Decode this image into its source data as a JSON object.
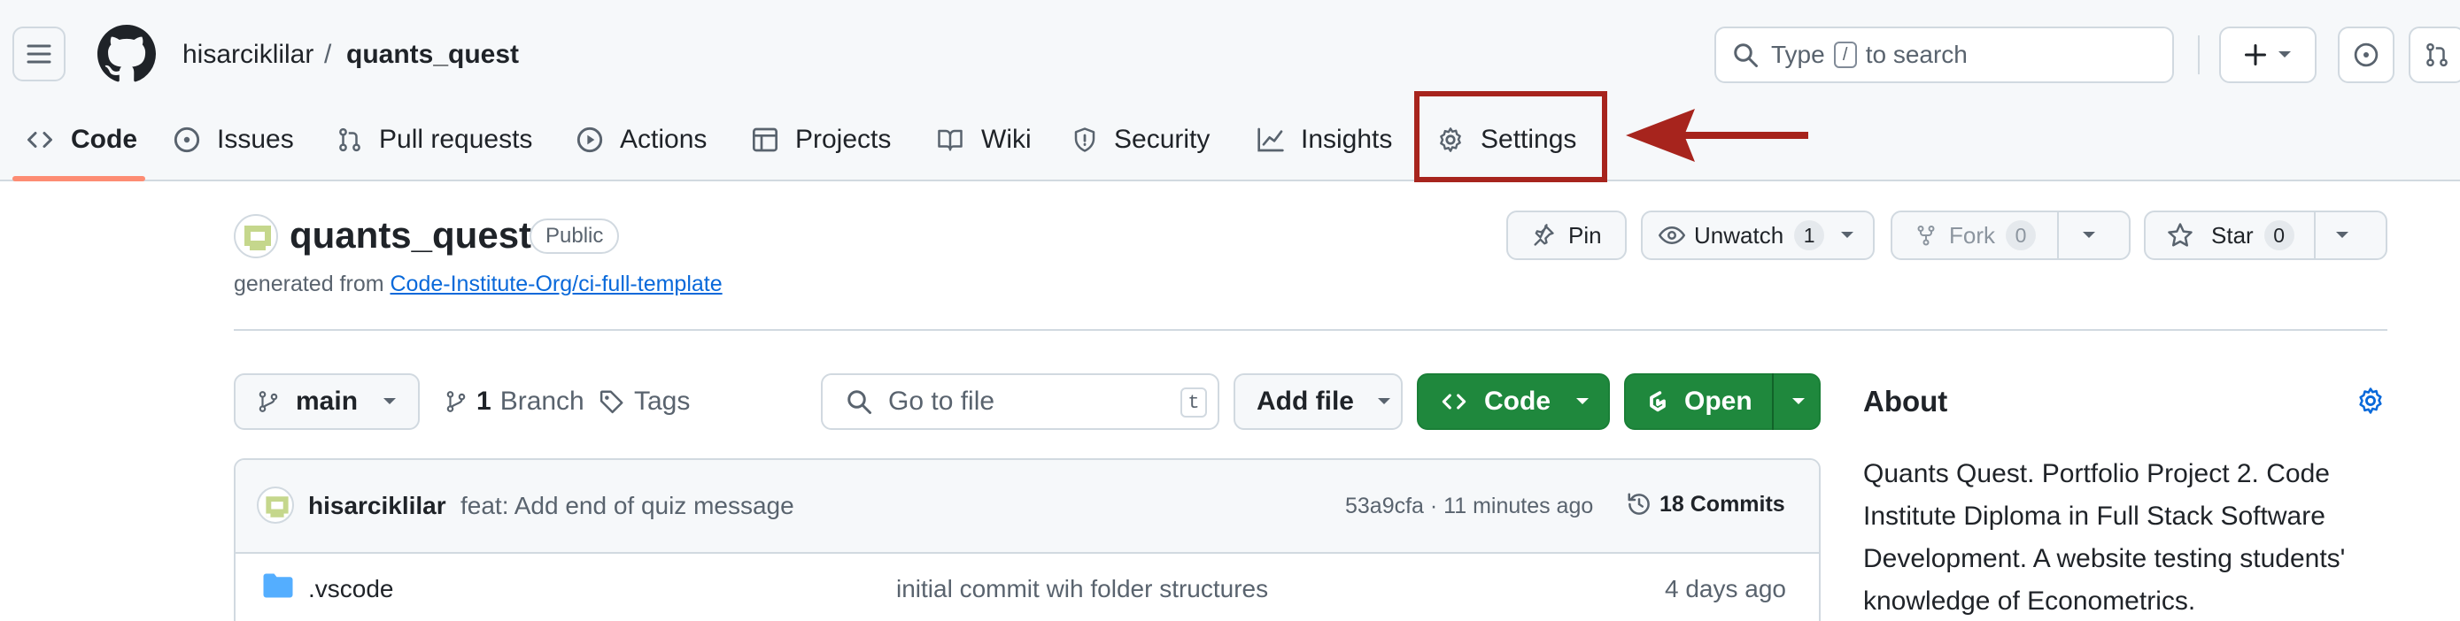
{
  "header": {
    "owner": "hisarciklilar",
    "separator": "/",
    "repo": "quants_quest",
    "search": {
      "prefix": "Type",
      "key": "/",
      "suffix": "to search"
    }
  },
  "tabs": [
    {
      "label": "Code",
      "icon": "code-icon",
      "active": true
    },
    {
      "label": "Issues",
      "icon": "issue-icon"
    },
    {
      "label": "Pull requests",
      "icon": "pull-request-icon"
    },
    {
      "label": "Actions",
      "icon": "play-icon"
    },
    {
      "label": "Projects",
      "icon": "table-icon"
    },
    {
      "label": "Wiki",
      "icon": "book-icon"
    },
    {
      "label": "Security",
      "icon": "shield-icon"
    },
    {
      "label": "Insights",
      "icon": "graph-icon"
    },
    {
      "label": "Settings",
      "icon": "gear-icon",
      "highlighted": true
    }
  ],
  "annotation": {
    "color": "#a7241d",
    "target": "Settings"
  },
  "repo": {
    "name": "quants_quest",
    "visibility": "Public",
    "generated_prefix": "generated from",
    "template_link": "Code-Institute-Org/ci-full-template"
  },
  "actions": {
    "pin": "Pin",
    "unwatch": "Unwatch",
    "unwatch_count": "1",
    "fork": "Fork",
    "fork_count": "0",
    "star": "Star",
    "star_count": "0"
  },
  "toolbar": {
    "branch": "main",
    "branch_count": "1",
    "branch_label": "Branch",
    "tags_label": "Tags",
    "goto_placeholder": "Go to file",
    "goto_key": "t",
    "add_file": "Add file",
    "code": "Code",
    "open": "Open"
  },
  "commit": {
    "author": "hisarciklilar",
    "message": "feat: Add end of quiz message",
    "meta": "53a9cfa · 11 minutes ago",
    "commits": "18 Commits"
  },
  "files": [
    {
      "name": ".vscode",
      "type": "folder",
      "message": "initial commit wih folder structures",
      "age": "4 days ago"
    }
  ],
  "about": {
    "title": "About",
    "description": "Quants Quest. Portfolio Project 2. Code Institute Diploma in Full Stack Software Development. A website testing students' knowledge of Econometrics."
  },
  "colors": {
    "accent": "#0969da",
    "green_button": "#1f883d",
    "tab_underline": "#fd8c73",
    "header_bg": "#f6f8fa"
  }
}
